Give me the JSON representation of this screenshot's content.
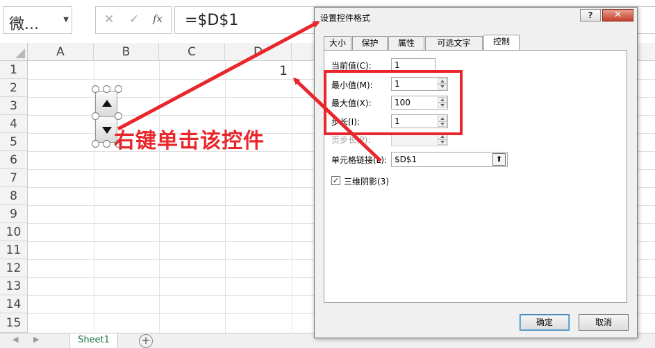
{
  "formula_bar": {
    "name_box": "微...",
    "cancel_icon": "✕",
    "enter_icon": "✓",
    "fx_label": "fx",
    "formula": "=$D$1"
  },
  "columns": [
    "A",
    "B",
    "C",
    "D"
  ],
  "rows": [
    "1",
    "2",
    "3",
    "4",
    "5",
    "6",
    "7",
    "8",
    "9",
    "10",
    "11",
    "12",
    "13",
    "14",
    "15"
  ],
  "cell_d1": "1",
  "callout": "右键单击该控件",
  "sheet_tab": "Sheet1",
  "add_sheet": "+",
  "dialog": {
    "title": "设置控件格式",
    "help": "?",
    "close": "✕",
    "tabs": [
      "大小",
      "保护",
      "属性",
      "可选文字",
      "控制"
    ],
    "active_tab": "控制",
    "current_value_label": "当前值(C):",
    "current_value": "1",
    "min_label": "最小值(M):",
    "min_value": "1",
    "max_label": "最大值(X):",
    "max_value": "100",
    "step_label": "步长(I):",
    "step_value": "1",
    "page_step_label": "页步长(P):",
    "cell_link_label": "单元格链接(L):",
    "cell_link_value": "$D$1",
    "shading_label": "三维阴影(3)",
    "shading_checked": "✓",
    "ok_label": "确定",
    "cancel_label": "取消"
  },
  "colors": {
    "accent_red": "#e8262b",
    "excel_green": "#217346"
  }
}
